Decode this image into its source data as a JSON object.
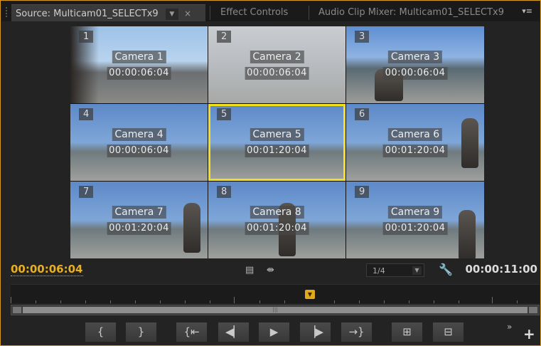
{
  "tabs": [
    {
      "label": "Source: Multicam01_SELECTx9",
      "active": true,
      "dropdown_icon": "chevron-down-icon",
      "close_icon": "close-icon"
    },
    {
      "label": "Effect Controls",
      "active": false
    },
    {
      "label": "Audio Clip Mixer: Multicam01_SELECTx9",
      "active": false
    }
  ],
  "panel_menu_icon": "panel-menu-icon",
  "cameras": [
    {
      "num": "1",
      "name": "Camera 1",
      "timecode": "00:00:06:04"
    },
    {
      "num": "2",
      "name": "Camera 2",
      "timecode": "00:00:06:04"
    },
    {
      "num": "3",
      "name": "Camera 3",
      "timecode": "00:00:06:04"
    },
    {
      "num": "4",
      "name": "Camera 4",
      "timecode": "00:00:06:04"
    },
    {
      "num": "5",
      "name": "Camera 5",
      "timecode": "00:01:20:04"
    },
    {
      "num": "6",
      "name": "Camera 6",
      "timecode": "00:01:20:04"
    },
    {
      "num": "7",
      "name": "Camera 7",
      "timecode": "00:01:20:04"
    },
    {
      "num": "8",
      "name": "Camera 8",
      "timecode": "00:01:20:04"
    },
    {
      "num": "9",
      "name": "Camera 9",
      "timecode": "00:01:20:04"
    }
  ],
  "selected_camera": "5",
  "selected_color": "#f0e020",
  "footer": {
    "current_timecode": "00:00:06:04",
    "duration_timecode": "00:00:11:00",
    "zoom_value": "1/4",
    "accent_color": "#e8b020"
  },
  "controls": [
    {
      "name": "mark-in-button",
      "icon": "{"
    },
    {
      "name": "mark-out-button",
      "icon": "}"
    },
    {
      "name": "go-to-in-button",
      "icon": "{⇤"
    },
    {
      "name": "step-back-button",
      "icon": "◀▏"
    },
    {
      "name": "play-button",
      "icon": "▶"
    },
    {
      "name": "step-forward-button",
      "icon": "▕▶"
    },
    {
      "name": "go-to-out-button",
      "icon": "→}"
    },
    {
      "name": "insert-button",
      "icon": "⊞"
    },
    {
      "name": "overwrite-button",
      "icon": "⊟"
    }
  ],
  "more_icon": "»",
  "add_icon": "+"
}
